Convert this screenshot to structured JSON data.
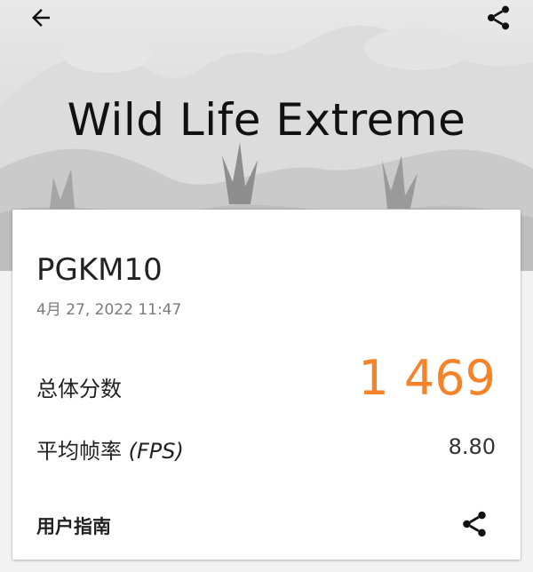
{
  "header": {
    "title": "Wild Life Extreme",
    "back_icon": "arrow-left-icon",
    "share_icon": "share-icon"
  },
  "result": {
    "device": "PGKM10",
    "date": "4月 27, 2022 11:47",
    "score_label": "总体分数",
    "score_value": "1 469",
    "fps_label_cn": "平均帧率 ",
    "fps_label_en": "(FPS)",
    "fps_value": "8.80",
    "guide_label": "用户指南"
  },
  "colors": {
    "accent": "#f4832a",
    "text": "#222222",
    "muted": "#7a7a7a"
  }
}
